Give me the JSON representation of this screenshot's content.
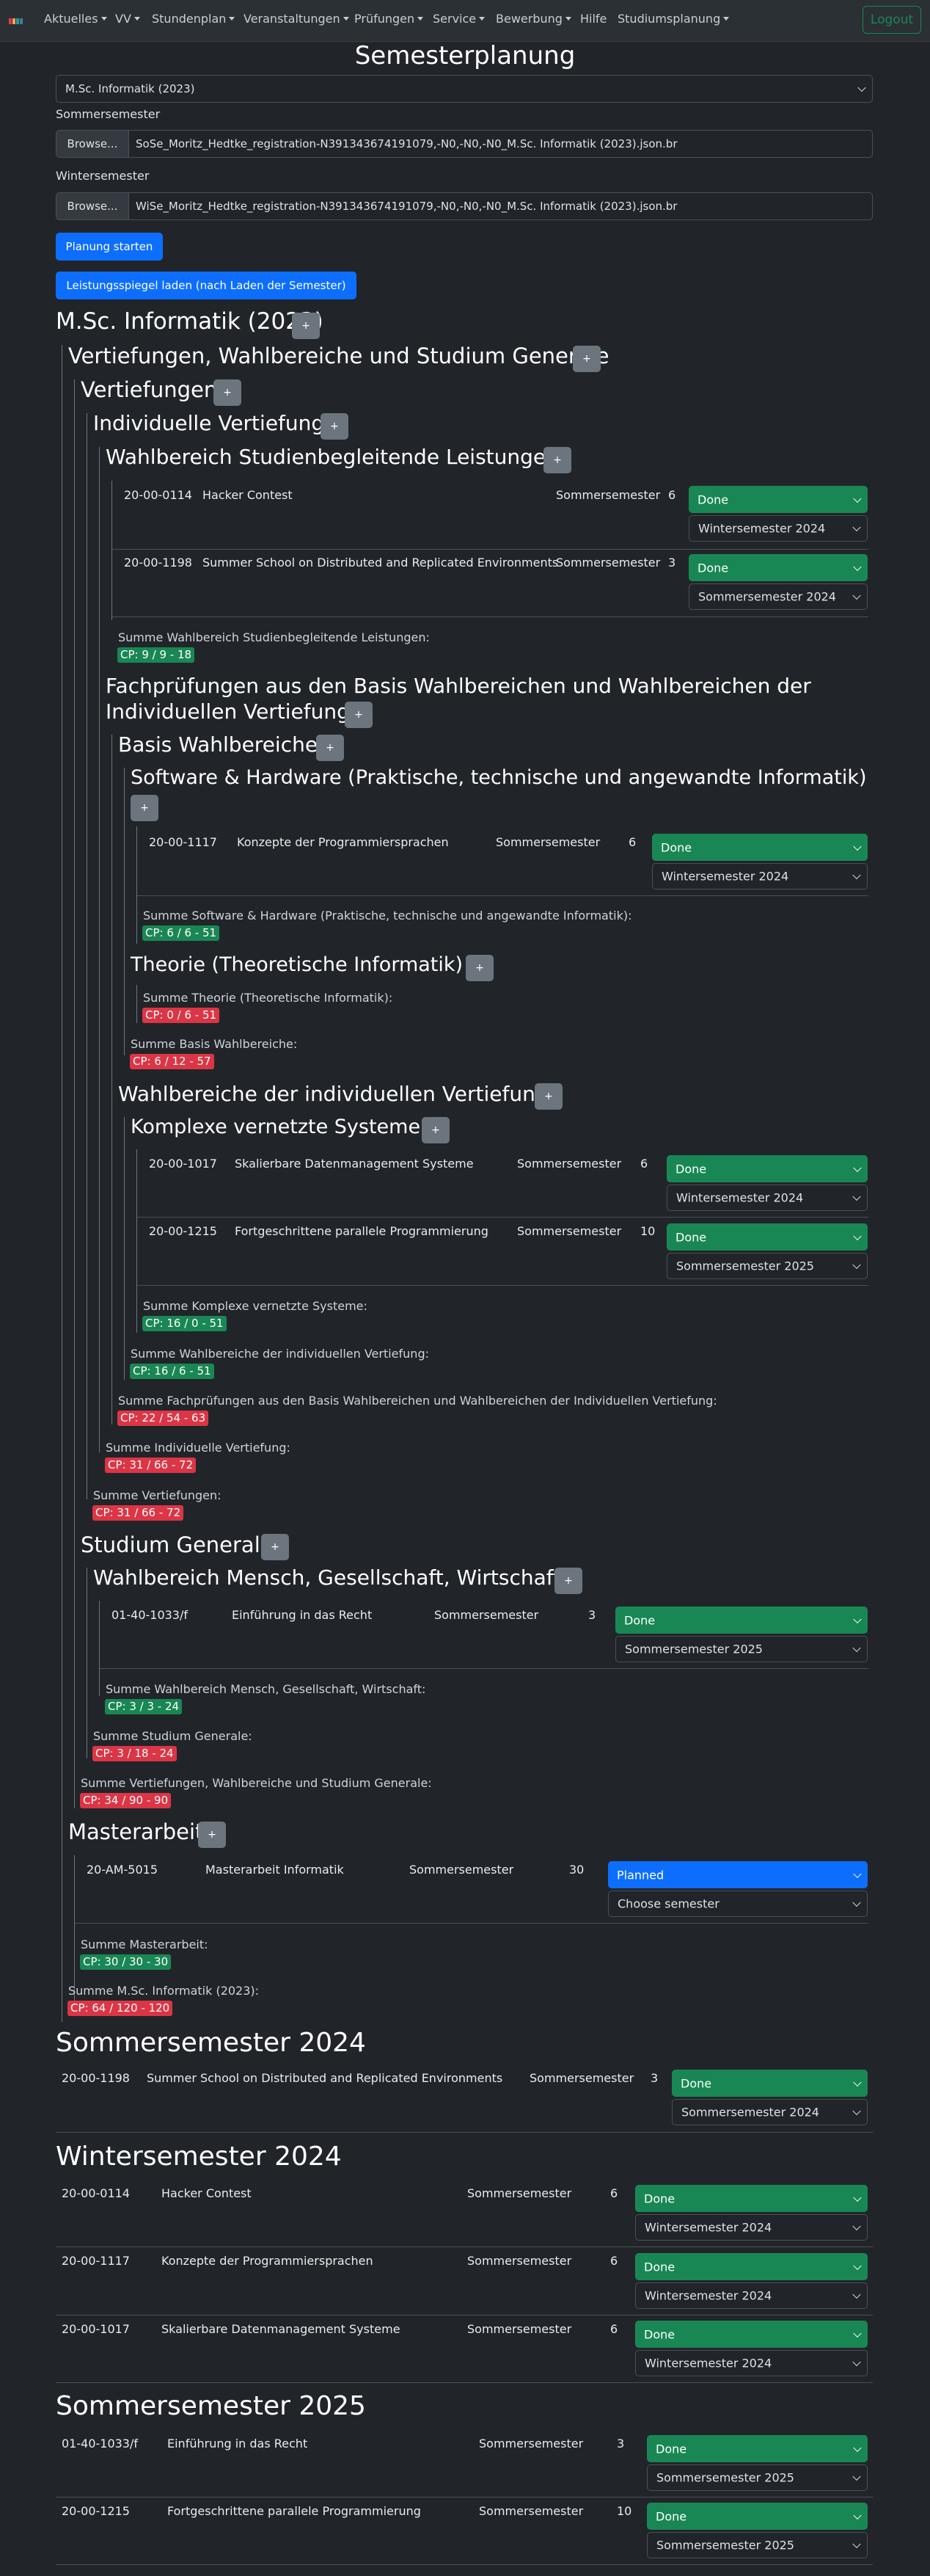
{
  "nav": {
    "items": [
      "Aktuelles",
      "VV",
      "Stundenplan",
      "Veranstaltungen",
      "Prüfungen",
      "Service",
      "Bewerbung",
      "Hilfe",
      "Studiumsplanung"
    ],
    "logout": "Logout",
    "logo_colors": [
      "#e63946",
      "#f4a261",
      "#2a9d8f",
      "#457b9d"
    ]
  },
  "page": {
    "title": "Semesterplanung",
    "program_select": "M.Sc. Informatik (2023)",
    "ss_label": "Sommersemester",
    "ws_label": "Wintersemester",
    "browse": "Browse...",
    "ss_file": "SoSe_Moritz_Hedtke_registration-N391343674191079,-N0,-N0,-N0_M.Sc. Informatik (2023).json.br",
    "ws_file": "WiSe_Moritz_Hedtke_registration-N391343674191079,-N0,-N0,-N0_M.Sc. Informatik (2023).json.br",
    "btn_start": "Planung starten",
    "btn_load": "Leistungsspiegel laden (nach Laden der Semester)"
  },
  "tree": {
    "plus": "+",
    "root": "M.Sc. Informatik (2023)",
    "vws": "Vertiefungen, Wahlbereiche und Studium Generale",
    "vert": "Vertiefungen",
    "iv": "Individuelle Vertiefung",
    "wsl": "Wahlbereich Studienbegleitende Leistungen",
    "wsl_c": [
      {
        "id": "20-00-0114",
        "name": "Hacker Contest",
        "term": "Sommersemester",
        "cp": "6",
        "status": "Done",
        "semester": "Wintersemester 2024"
      },
      {
        "id": "20-00-1198",
        "name": "Summer School on Distributed and Replicated Environments",
        "term": "Sommersemester",
        "cp": "3",
        "status": "Done",
        "semester": "Sommersemester 2024"
      }
    ],
    "wsl_sum": "Summe Wahlbereich Studienbegleitende Leistungen:",
    "wsl_cp": "CP: 9 / 9 - 18",
    "fp_l1": "Fachprüfungen aus den Basis Wahlbereichen und Wahlbereichen der",
    "fp_l2": "Individuellen Vertiefung",
    "bw": "Basis Wahlbereiche",
    "sh": "Software & Hardware (Praktische, technische und angewandte Informatik)",
    "sh_c": [
      {
        "id": "20-00-1117",
        "name": "Konzepte der Programmiersprachen",
        "term": "Sommersemester",
        "cp": "6",
        "status": "Done",
        "semester": "Wintersemester 2024"
      }
    ],
    "sh_sum": "Summe Software & Hardware (Praktische, technische und angewandte Informatik):",
    "sh_cp": "CP: 6 / 6 - 51",
    "th": "Theorie (Theoretische Informatik)",
    "th_sum": "Summe Theorie (Theoretische Informatik):",
    "th_cp": "CP: 0 / 6 - 51",
    "bw_sum": "Summe Basis Wahlbereiche:",
    "bw_cp": "CP: 6 / 12 - 57",
    "wiv": "Wahlbereiche der individuellen Vertiefung",
    "kvs": "Komplexe vernetzte Systeme",
    "kvs_c": [
      {
        "id": "20-00-1017",
        "name": "Skalierbare Datenmanagement Systeme",
        "term": "Sommersemester",
        "cp": "6",
        "status": "Done",
        "semester": "Wintersemester 2024"
      },
      {
        "id": "20-00-1215",
        "name": "Fortgeschrittene parallele Programmierung",
        "term": "Sommersemester",
        "cp": "10",
        "status": "Done",
        "semester": "Sommersemester 2025"
      }
    ],
    "kvs_sum": "Summe Komplexe vernetzte Systeme:",
    "kvs_cp": "CP: 16 / 0 - 51",
    "wiv_sum": "Summe Wahlbereiche der individuellen Vertiefung:",
    "wiv_cp": "CP: 16 / 6 - 51",
    "fp_sum": "Summe Fachprüfungen aus den Basis Wahlbereichen und Wahlbereichen der Individuellen Vertiefung:",
    "fp_cp": "CP: 22 / 54 - 63",
    "iv_sum": "Summe Individuelle Vertiefung:",
    "iv_cp": "CP: 31 / 66 - 72",
    "vert_sum": "Summe Vertiefungen:",
    "vert_cp": "CP: 31 / 66 - 72",
    "sg": "Studium Generale",
    "wmgw": "Wahlbereich Mensch, Gesellschaft, Wirtschaft",
    "wmgw_c": [
      {
        "id": "01-40-1033/f",
        "name": "Einführung in das Recht",
        "term": "Sommersemester",
        "cp": "3",
        "status": "Done",
        "semester": "Sommersemester 2025"
      }
    ],
    "wmgw_sum": "Summe Wahlbereich Mensch, Gesellschaft, Wirtschaft:",
    "wmgw_cp": "CP: 3 / 3 - 24",
    "sg_sum": "Summe Studium Generale:",
    "sg_cp": "CP: 3 / 18 - 24",
    "vws_sum": "Summe Vertiefungen, Wahlbereiche und Studium Generale:",
    "vws_cp": "CP: 34 / 90 - 90",
    "ma": "Masterarbeit",
    "ma_c": [
      {
        "id": "20-AM-5015",
        "name": "Masterarbeit Informatik",
        "term": "Sommersemester",
        "cp": "30",
        "status": "Planned",
        "semester": "Choose semester"
      }
    ],
    "ma_sum": "Summe Masterarbeit:",
    "ma_cp": "CP: 30 / 30 - 30",
    "root_sum": "Summe M.Sc. Informatik (2023):",
    "root_cp": "CP: 64 / 120 - 120"
  },
  "semesters": [
    {
      "title": "Sommersemester 2024",
      "courses": [
        {
          "id": "20-00-1198",
          "name": "Summer School on Distributed and Replicated Environments",
          "term": "Sommersemester",
          "cp": "3",
          "status": "Done",
          "semester": "Sommersemester 2024"
        }
      ]
    },
    {
      "title": "Wintersemester 2024",
      "courses": [
        {
          "id": "20-00-0114",
          "name": "Hacker Contest",
          "term": "Sommersemester",
          "cp": "6",
          "status": "Done",
          "semester": "Wintersemester 2024"
        },
        {
          "id": "20-00-1117",
          "name": "Konzepte der Programmiersprachen",
          "term": "Sommersemester",
          "cp": "6",
          "status": "Done",
          "semester": "Wintersemester 2024"
        },
        {
          "id": "20-00-1017",
          "name": "Skalierbare Datenmanagement Systeme",
          "term": "Sommersemester",
          "cp": "6",
          "status": "Done",
          "semester": "Wintersemester 2024"
        }
      ]
    },
    {
      "title": "Sommersemester 2025",
      "courses": [
        {
          "id": "01-40-1033/f",
          "name": "Einführung in das Recht",
          "term": "Sommersemester",
          "cp": "3",
          "status": "Done",
          "semester": "Sommersemester 2025"
        },
        {
          "id": "20-00-1215",
          "name": "Fortgeschrittene parallele Programmierung",
          "term": "Sommersemester",
          "cp": "10",
          "status": "Done",
          "semester": "Sommersemester 2025"
        }
      ]
    }
  ],
  "colors": {
    "done": "#198754",
    "planned": "#0d6efd",
    "cp_ok": "#198754",
    "cp_missing": "#dc3545"
  }
}
